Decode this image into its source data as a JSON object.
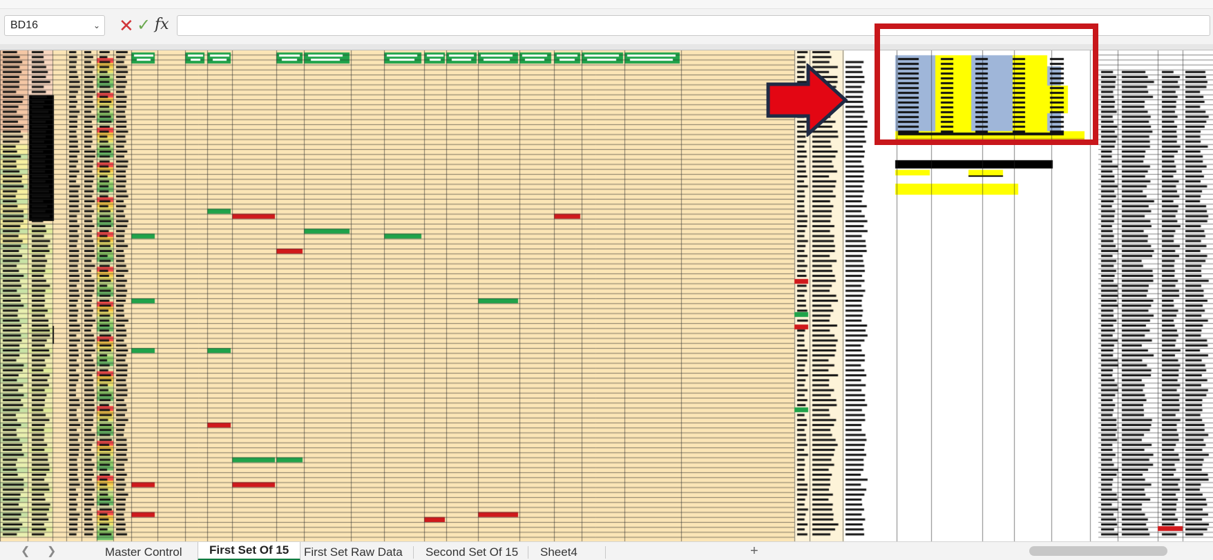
{
  "formula_bar": {
    "name_box": "BD16",
    "name_box_dropdown_icon": "chevron-down-icon",
    "cancel_icon": "cancel-x-icon",
    "enter_icon": "checkmark-icon",
    "function_label": "fx",
    "formula_value": ""
  },
  "sheet_tabs": {
    "tabs": [
      "Master Control",
      "First Set Of 15",
      "First Set Raw Data",
      "Second Set Of 15",
      "Sheet4"
    ],
    "active_index": 1,
    "add_label": "+"
  },
  "annotation": {
    "highlight_color": "#c8171b",
    "arrow_color": "#e30613",
    "arrow_outline_color": "#1f2a44"
  },
  "colors": {
    "cream_fill": "#fbe5b6",
    "green_fill": "#1fa34a",
    "red_fill": "#d0191c",
    "yellow_fill": "#ffff00",
    "blue_fill": "#9fb6d9",
    "black_fill": "#000000"
  }
}
